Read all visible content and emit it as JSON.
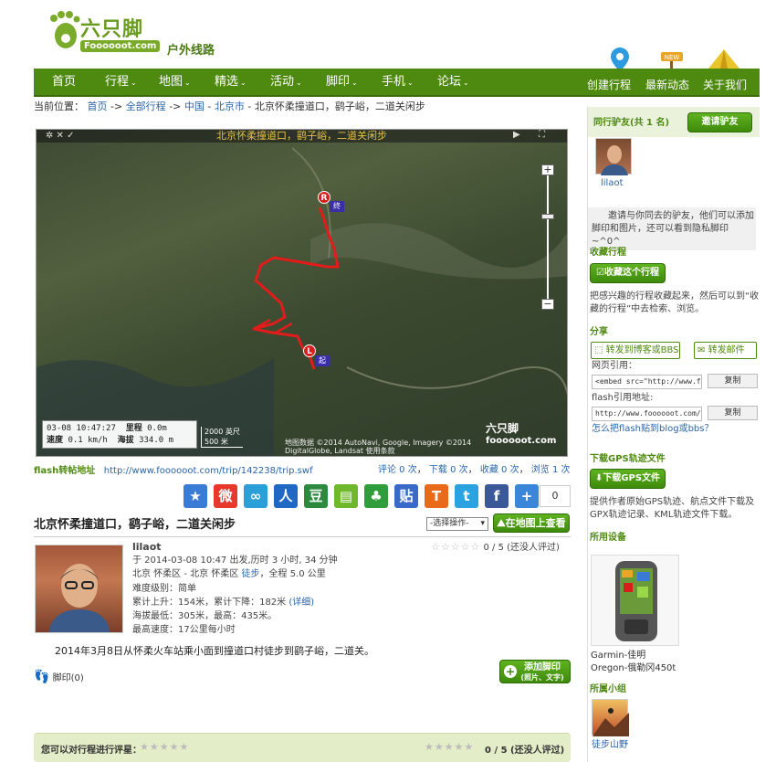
{
  "header": {
    "logo_text": "六只脚",
    "logo_domain": "Foooooot.com",
    "subtitle": "户外线路",
    "icons": [
      {
        "label": "创建行程",
        "icon": "map-pin-icon"
      },
      {
        "label": "最新动态",
        "icon": "new-sign-icon"
      },
      {
        "label": "关于我们",
        "icon": "tent-icon"
      }
    ]
  },
  "nav": {
    "items": [
      {
        "label": "首页",
        "caret": false
      },
      {
        "label": "行程",
        "caret": true
      },
      {
        "label": "地图",
        "caret": true
      },
      {
        "label": "精选",
        "caret": true
      },
      {
        "label": "活动",
        "caret": true
      },
      {
        "label": "脚印",
        "caret": true
      },
      {
        "label": "手机",
        "caret": true
      },
      {
        "label": "论坛",
        "caret": true
      }
    ]
  },
  "breadcrumb": {
    "prefix": "当前位置：",
    "items": [
      "首页",
      "->",
      "全部行程",
      "->",
      "中国",
      "-",
      "北京市",
      "- 北京怀柔撞道口，鹞子峪，二道关闲步"
    ]
  },
  "map": {
    "title": "北京怀柔撞道口，鹞子峪，二道关闲步",
    "info_date": "03-08 10:47:27",
    "info_dist_label": "里程",
    "info_dist": "0.0m",
    "info_speed_label": "速度",
    "info_speed": "0.1 km/h",
    "info_alt_label": "海拔",
    "info_alt": "334.0 m",
    "scale_top": "2000 英尺",
    "scale_bottom": "500 米",
    "copyright": "地图数据 ©2014 AutoNavi, Google, Imagery ©2014 DigitalGlobe, Landsat 使用条款",
    "logo": "六只脚",
    "logo_domain": "foooooot.com",
    "start_marker": "L",
    "start_flag": "起",
    "end_marker": "R",
    "end_flag": "终"
  },
  "flash": {
    "label": "flash转帖地址",
    "url": "http://www.foooooot.com/trip/142238/trip.swf"
  },
  "stats": {
    "comment": "评论 0 次",
    "download": "下载 0 次",
    "favorite": "收藏 0 次",
    "view": "浏览 1 次"
  },
  "share": {
    "count": "0",
    "icons": [
      "star-icon",
      "weibo-icon",
      "tencent-weibo-icon",
      "renren-icon",
      "douban-icon",
      "kaixin-icon",
      "clover-icon",
      "tieba-icon",
      "t-icon",
      "twitter-icon",
      "facebook-icon",
      "plus-icon"
    ]
  },
  "trip": {
    "title": "北京怀柔撞道口，鹞子峪，二道关闲步",
    "select": "-选择操作-",
    "map_view_btn": "在地图上查看",
    "user": "lilaot",
    "line1": "于 2014-03-08 10:47 出发,历时 3 小时, 34 分钟",
    "line2": "北京 怀柔区 - 北京 怀柔区",
    "line2_link": "徒步",
    "line2_tail": "，全程 5.0 公里",
    "difficulty": "难度级别：简单",
    "ascent": "累计上升：154米，累计下降：182米",
    "ascent_link": "(详细)",
    "altitude": "海拔最低：305米，最高：435米。",
    "max_speed": "最高速度：17公里每小时",
    "rating": "0 / 5 (还没人评过)",
    "description": "2014年3月8日从怀柔火车站乘小面到撞道口村徒步到鹞子峪，二道关。",
    "footprint": "脚印(0)",
    "add_btn_main": "添加脚印",
    "add_btn_sub": "(照片、文字)",
    "rate_prompt": "您可以对行程进行评星：",
    "rate_result": "0 / 5 (还没人评过)"
  },
  "sidebar": {
    "companions": "同行驴友(共 1 名)",
    "invite_btn": "邀请驴友",
    "companion_user": "lilaot",
    "invite_text": "邀请与你同去的驴友，他们可以添加脚印和图片，还可以看到隐私脚印~^0^",
    "fav_title": "收藏行程",
    "fav_btn": "收藏这个行程",
    "fav_text": "把感兴趣的行程收藏起来，然后可以到“收藏的行程”中去检索、浏览。",
    "share_title": "分享",
    "share_blog": "转发到博客或BBS",
    "share_mail": "转发邮件",
    "web_ref": "网页引用：",
    "web_code": "<embed src=\"http://www.f",
    "copy1": "复制",
    "flash_ref": "flash引用地址:",
    "flash_code": "http://www.foooooot.com/",
    "copy2": "复制",
    "how_link": "怎么把flash贴到blog或bbs？",
    "gps_title": "下载GPS轨迹文件",
    "gps_btn": "下载GPS文件",
    "gps_text": "提供作者原始GPS轨迹、航点文件下载及GPX轨迹记录、KML轨迹文件下载。",
    "device_title": "所用设备",
    "device_name": "Garmin-佳明Oregon-俄勒冈450t",
    "group_title": "所属小组",
    "group_name": "徒步山野"
  }
}
